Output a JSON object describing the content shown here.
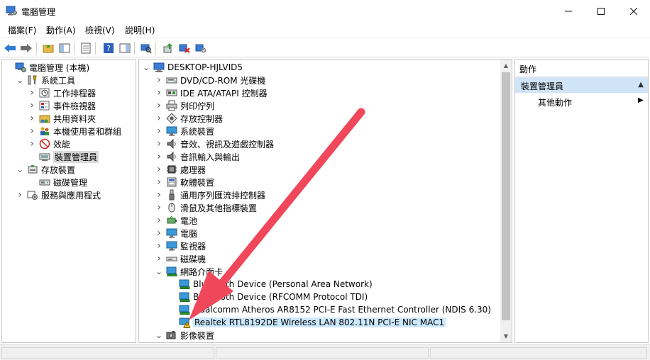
{
  "window": {
    "title": "電腦管理"
  },
  "menu": [
    "檔案(F)",
    "動作(A)",
    "檢視(V)",
    "說明(H)"
  ],
  "left_tree": [
    {
      "label": "電腦管理 (本機)",
      "level": 0,
      "expand": "",
      "icon": "computer-mgmt-icon"
    },
    {
      "label": "系統工具",
      "level": 1,
      "expand": "open",
      "icon": "tools-icon"
    },
    {
      "label": "工作排程器",
      "level": 2,
      "expand": "closed",
      "icon": "clock-icon"
    },
    {
      "label": "事件檢視器",
      "level": 2,
      "expand": "closed",
      "icon": "event-viewer-icon"
    },
    {
      "label": "共用資料夾",
      "level": 2,
      "expand": "closed",
      "icon": "shared-folder-icon"
    },
    {
      "label": "本機使用者和群組",
      "level": 2,
      "expand": "closed",
      "icon": "users-icon"
    },
    {
      "label": "效能",
      "level": 2,
      "expand": "closed",
      "icon": "performance-icon"
    },
    {
      "label": "裝置管理員",
      "level": 2,
      "expand": "",
      "icon": "device-manager-icon",
      "selected": true
    },
    {
      "label": "存放裝置",
      "level": 1,
      "expand": "open",
      "icon": "storage-icon"
    },
    {
      "label": "磁碟管理",
      "level": 2,
      "expand": "",
      "icon": "disk-mgmt-icon"
    },
    {
      "label": "服務與應用程式",
      "level": 1,
      "expand": "closed",
      "icon": "services-icon"
    }
  ],
  "device_tree": [
    {
      "label": "DESKTOP-HJLVID5",
      "level": 0,
      "expand": "open",
      "icon": "computer-icon"
    },
    {
      "label": "DVD/CD-ROM 光碟機",
      "level": 1,
      "expand": "closed",
      "icon": "dvd-icon"
    },
    {
      "label": "IDE ATA/ATAPI 控制器",
      "level": 1,
      "expand": "closed",
      "icon": "ide-icon"
    },
    {
      "label": "列印佇列",
      "level": 1,
      "expand": "closed",
      "icon": "printer-icon"
    },
    {
      "label": "存放控制器",
      "level": 1,
      "expand": "closed",
      "icon": "storage-controller-icon"
    },
    {
      "label": "系統裝置",
      "level": 1,
      "expand": "closed",
      "icon": "monitor-icon"
    },
    {
      "label": "音效、視訊及遊戲控制器",
      "level": 1,
      "expand": "closed",
      "icon": "speaker-icon"
    },
    {
      "label": "音訊輸入與輸出",
      "level": 1,
      "expand": "closed",
      "icon": "speaker-icon"
    },
    {
      "label": "處理器",
      "level": 1,
      "expand": "closed",
      "icon": "cpu-icon"
    },
    {
      "label": "軟體裝置",
      "level": 1,
      "expand": "closed",
      "icon": "software-device-icon"
    },
    {
      "label": "通用序列匯流排控制器",
      "level": 1,
      "expand": "closed",
      "icon": "usb-icon"
    },
    {
      "label": "滑鼠及其他指標裝置",
      "level": 1,
      "expand": "closed",
      "icon": "mouse-icon"
    },
    {
      "label": "電池",
      "level": 1,
      "expand": "closed",
      "icon": "battery-icon"
    },
    {
      "label": "電腦",
      "level": 1,
      "expand": "closed",
      "icon": "monitor-icon"
    },
    {
      "label": "監視器",
      "level": 1,
      "expand": "closed",
      "icon": "monitor-icon"
    },
    {
      "label": "磁碟機",
      "level": 1,
      "expand": "closed",
      "icon": "disk-drive-icon"
    },
    {
      "label": "網路介面卡",
      "level": 1,
      "expand": "open",
      "icon": "network-icon"
    },
    {
      "label": "Bluetooth Device (Personal Area Network)",
      "level": 2,
      "expand": "",
      "icon": "network-adapter-icon"
    },
    {
      "label": "Bluetooth Device (RFCOMM Protocol TDI)",
      "level": 2,
      "expand": "",
      "icon": "network-adapter-icon"
    },
    {
      "label": "Qualcomm Atheros AR8152 PCI-E Fast Ethernet Controller (NDIS 6.30)",
      "level": 2,
      "expand": "",
      "icon": "network-adapter-icon"
    },
    {
      "label": "Realtek RTL8192DE Wireless LAN 802.11N PCI-E NIC MAC1",
      "level": 2,
      "expand": "",
      "icon": "warning-adapter-icon",
      "selected": true
    },
    {
      "label": "影像裝置",
      "level": 1,
      "expand": "open",
      "icon": "camera-icon"
    }
  ],
  "actions": {
    "header": "動作",
    "section": "裝置管理員",
    "item": "其他動作"
  },
  "colors": {
    "selection": "#cce8ff",
    "section": "#cfe4f7",
    "arrow": "#f0475a"
  }
}
